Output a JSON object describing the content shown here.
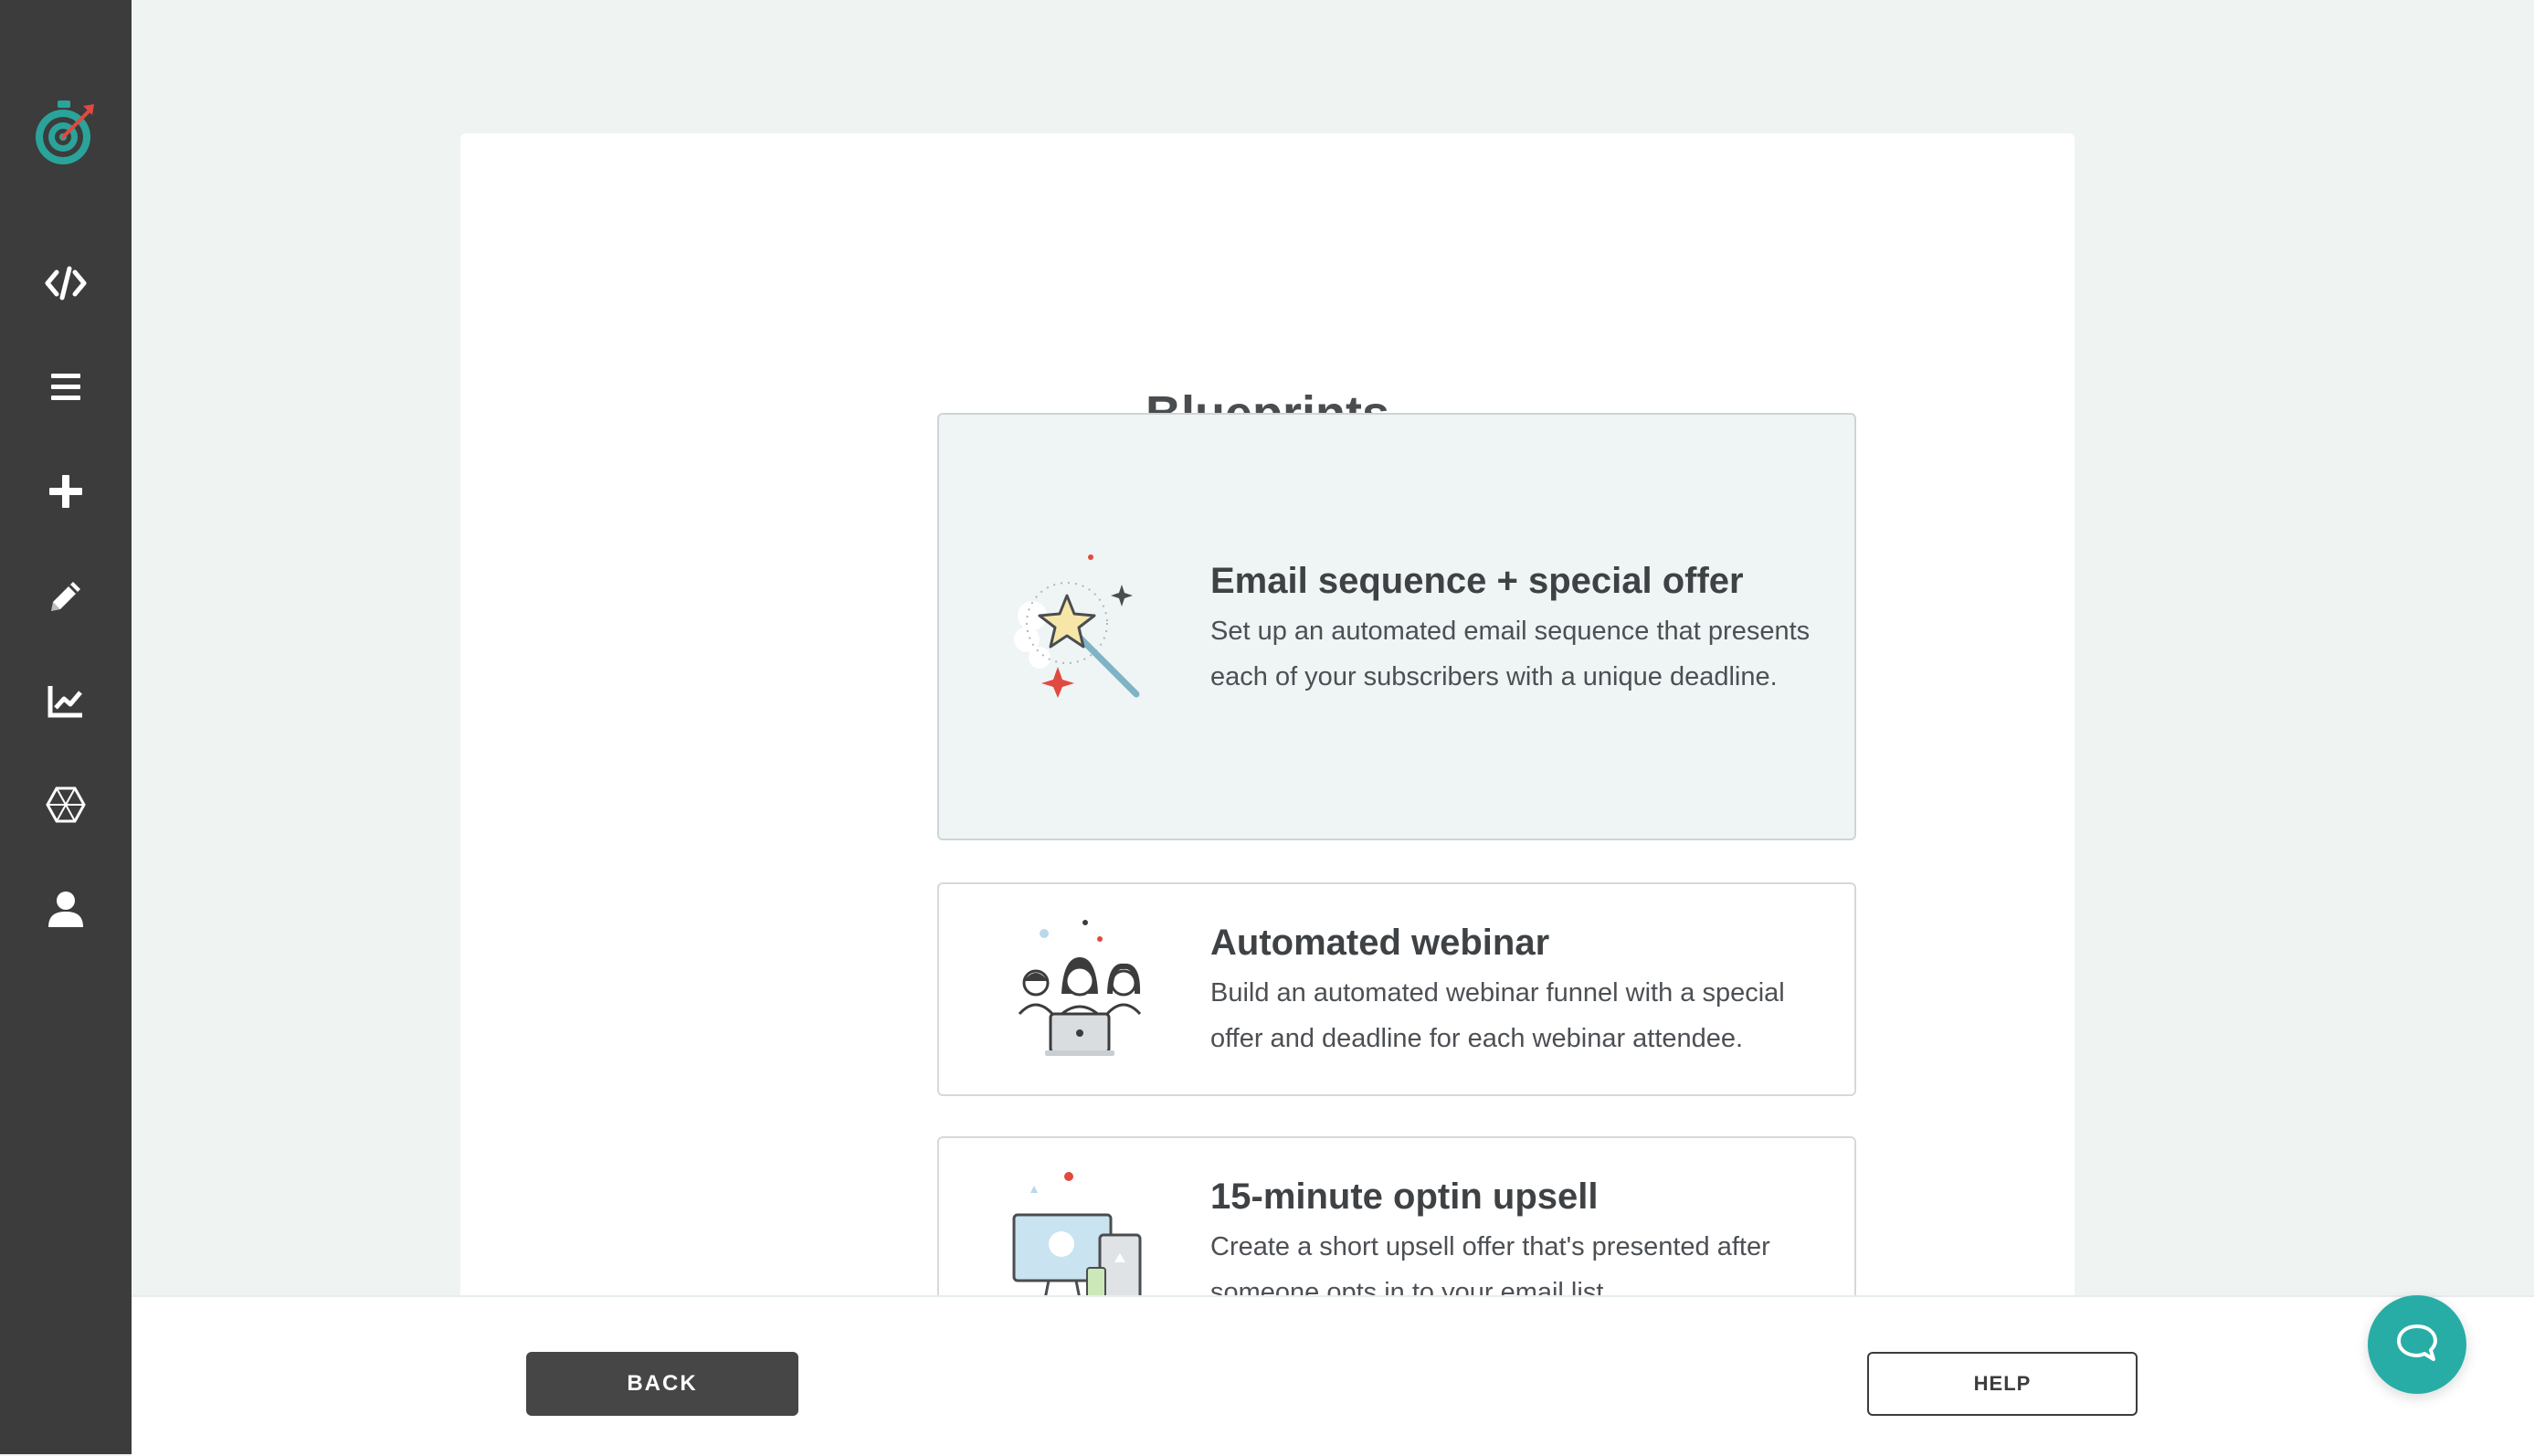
{
  "sidebar": {
    "logo_icon": "target-stopwatch-logo-icon",
    "items": [
      {
        "icon": "code-icon"
      },
      {
        "icon": "menu-icon"
      },
      {
        "icon": "plus-icon"
      },
      {
        "icon": "pencil-icon"
      },
      {
        "icon": "chart-icon"
      },
      {
        "icon": "integrations-icon"
      },
      {
        "icon": "user-icon"
      }
    ]
  },
  "page": {
    "title": "Blueprints"
  },
  "blueprints": [
    {
      "title": "Email sequence + special offer",
      "description": "Set up an automated email sequence that presents each of your subscribers with a unique deadline.",
      "illustration": "magic-wand-illustration",
      "selected": true
    },
    {
      "title": "Automated webinar",
      "description": "Build an automated webinar funnel with a special offer and deadline for each webinar attendee.",
      "illustration": "webinar-audience-illustration",
      "selected": false
    },
    {
      "title": "15-minute optin upsell",
      "description": "Create a short upsell offer that's presented after someone opts in to your email list.",
      "illustration": "devices-illustration",
      "selected": false
    }
  ],
  "footer": {
    "back_label": "BACK",
    "help_label": "HELP"
  },
  "chat": {
    "icon": "chat-bubble-icon"
  },
  "colors": {
    "sidebar": "#3c3c3c",
    "accent": "#27ada6",
    "background": "#eff4f3",
    "selected_card": "#eff4f4"
  }
}
